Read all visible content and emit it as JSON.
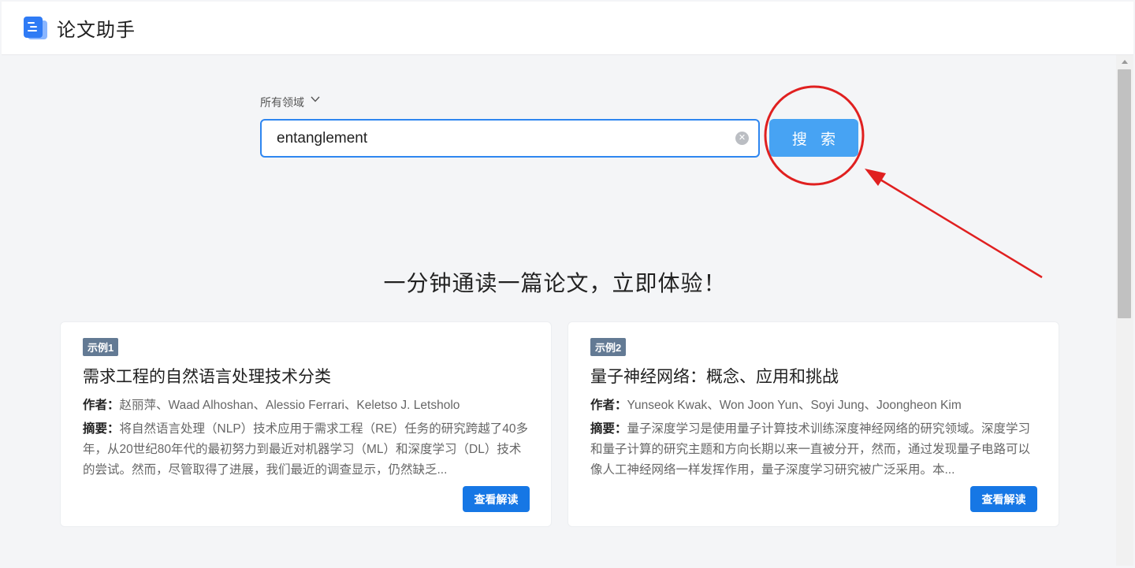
{
  "app": {
    "title": "论文助手"
  },
  "search": {
    "domain_label": "所有领域",
    "query": "entanglement",
    "button_label": "搜 索"
  },
  "headline": "一分钟通读一篇论文，立即体验！",
  "cards": [
    {
      "badge": "示例1",
      "title": "需求工程的自然语言处理技术分类",
      "author_label": "作者：",
      "authors": "赵丽萍、Waad Alhoshan、Alessio Ferrari、Keletso J. Letsholo",
      "abstract_label": "摘要：",
      "abstract": "将自然语言处理（NLP）技术应用于需求工程（RE）任务的研究跨越了40多年，从20世纪80年代的最初努力到最近对机器学习（ML）和深度学习（DL）技术的尝试。然而，尽管取得了进展，我们最近的调查显示，仍然缺乏...",
      "button_label": "查看解读"
    },
    {
      "badge": "示例2",
      "title": "量子神经网络：概念、应用和挑战",
      "author_label": "作者：",
      "authors": "Yunseok Kwak、Won Joon Yun、Soyi Jung、Joongheon Kim",
      "abstract_label": "摘要：",
      "abstract": "量子深度学习是使用量子计算技术训练深度神经网络的研究领域。深度学习和量子计算的研究主题和方向长期以来一直被分开，然而，通过发现量子电路可以像人工神经网络一样发挥作用，量子深度学习研究被广泛采用。本...",
      "button_label": "查看解读"
    }
  ],
  "colors": {
    "accent": "#2e86f0",
    "search_button": "#47a3f3",
    "view_button": "#1677e5",
    "annotation": "#e02020"
  }
}
